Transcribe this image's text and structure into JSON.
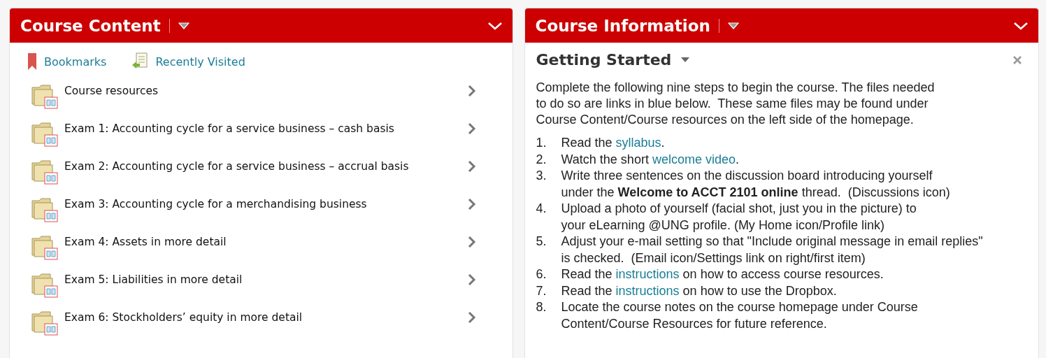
{
  "panels": [
    {
      "title": "Course Content",
      "kind": "content",
      "links": [
        {
          "label": "Bookmarks",
          "kind": "bookmark"
        },
        {
          "label": "Recently Visited",
          "kind": "recent"
        }
      ],
      "items": [
        {
          "label": "Course resources"
        },
        {
          "label": "Exam 1: Accounting cycle for a service business – cash basis"
        },
        {
          "label": "Exam 2: Accounting cycle for a service business – accrual basis"
        },
        {
          "label": "Exam 3: Accounting cycle for a merchandising business"
        },
        {
          "label": "Exam 4: Assets in more detail"
        },
        {
          "label": "Exam 5: Liabilities in more detail"
        },
        {
          "label": "Exam 6: Stockholders’ equity in more detail"
        }
      ]
    },
    {
      "title": "Course Information",
      "kind": "info",
      "heading": "Getting Started",
      "intro": "Complete the following nine steps to begin the course. The files needed\nto do so are links in blue below.  These same files may be found under\nCourse Content/Course resources on the left side of the homepage.",
      "steps": [
        {
          "number": "1.",
          "parts": [
            {
              "kind": "text",
              "text": "Read the "
            },
            {
              "kind": "link",
              "text": "syllabus"
            },
            {
              "kind": "text",
              "text": "."
            }
          ]
        },
        {
          "number": "2.",
          "parts": [
            {
              "kind": "text",
              "text": "Watch the short "
            },
            {
              "kind": "link",
              "text": "welcome video"
            },
            {
              "kind": "text",
              "text": "."
            }
          ]
        },
        {
          "number": "3.",
          "parts": [
            {
              "kind": "text",
              "text": "Write three sentences on the discussion board introducing yourself\nunder the "
            },
            {
              "kind": "bold",
              "text": "Welcome to ACCT 2101 online"
            },
            {
              "kind": "text",
              "text": " thread.  (Discussions icon)"
            }
          ]
        },
        {
          "number": "4.",
          "parts": [
            {
              "kind": "text",
              "text": "Upload a photo of yourself (facial shot, just you in the picture) to\nyour eLearning @UNG profile. (My Home icon/Profile link)"
            }
          ]
        },
        {
          "number": "5.",
          "parts": [
            {
              "kind": "text",
              "text": "Adjust your e-mail setting so that \"Include original message in email replies\"\nis checked.  (Email icon/Settings link on right/first item)"
            }
          ]
        },
        {
          "number": "6.",
          "parts": [
            {
              "kind": "text",
              "text": "Read the "
            },
            {
              "kind": "link",
              "text": "instructions"
            },
            {
              "kind": "text",
              "text": " on how to access course resources."
            }
          ]
        },
        {
          "number": "7.",
          "parts": [
            {
              "kind": "text",
              "text": "Read the "
            },
            {
              "kind": "link",
              "text": "instructions"
            },
            {
              "kind": "text",
              "text": " on how to use the Dropbox."
            }
          ]
        },
        {
          "number": "8.",
          "parts": [
            {
              "kind": "text",
              "text": "Locate the course notes on the course homepage under Course\nContent/Course Resources for future reference."
            }
          ]
        }
      ]
    }
  ]
}
